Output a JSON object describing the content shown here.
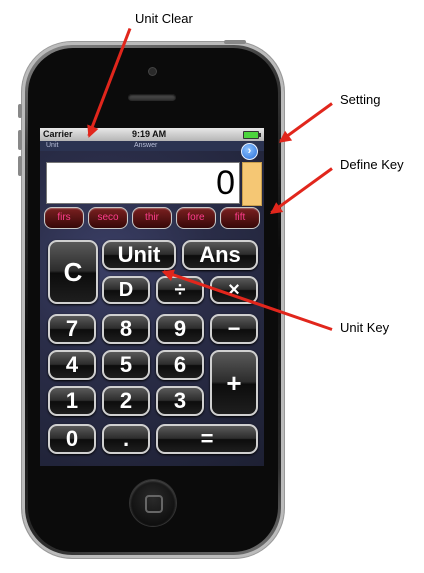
{
  "callouts": {
    "unit_clear": "Unit Clear",
    "setting": "Setting",
    "define_key": "Define Key",
    "unit_key": "Unit Key"
  },
  "status_bar": {
    "carrier": "Carrier",
    "time": "9:19 AM"
  },
  "labels": {
    "unit": "Unit",
    "answer": "Answer"
  },
  "display": {
    "value": "0"
  },
  "setting_button": {
    "glyph": "›"
  },
  "unit_keys": [
    "firs",
    "seco",
    "thir",
    "fore",
    "fift"
  ],
  "keys": {
    "clear": "C",
    "unit": "Unit",
    "ans": "Ans",
    "d": "D",
    "divide": "÷",
    "multiply": "×",
    "minus": "−",
    "plus": "+",
    "equals": "=",
    "dot": ".",
    "digits": {
      "0": "0",
      "1": "1",
      "2": "2",
      "3": "3",
      "4": "4",
      "5": "5",
      "6": "6",
      "7": "7",
      "8": "8",
      "9": "9"
    }
  },
  "colors": {
    "arrow": "#e1261c",
    "unit_key_text": "#ff3c8c",
    "define_key": "#f5c774",
    "setting": "#2a6fd9"
  }
}
